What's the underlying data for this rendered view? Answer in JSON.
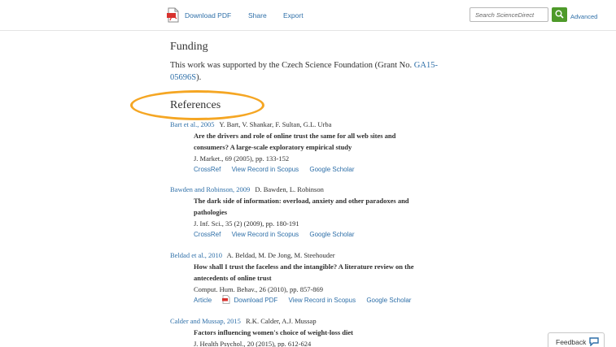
{
  "toolbar": {
    "download_pdf": "Download PDF",
    "share": "Share",
    "export": "Export",
    "search_placeholder": "Search ScienceDirect",
    "advanced": "Advanced"
  },
  "funding": {
    "heading": "Funding",
    "text": "This work was supported by the Czech Science Foundation (Grant No.",
    "grant_link": "GA15-05696S",
    "text_end": ")."
  },
  "references": {
    "heading": "References",
    "items": [
      {
        "key": "Bart et al., 2005",
        "authors": "Y. Bart, V. Shankar, F. Sultan, G.L. Urba",
        "title_line1": "Are the drivers and role of online trust the same for all web sites and",
        "title_line2": "consumers? A large-scale exploratory empirical study",
        "source": "J. Market., 69 (2005), pp. 133-152",
        "links": [
          "CrossRef",
          "View Record in Scopus",
          "Google Scholar"
        ]
      },
      {
        "key": "Bawden and Robinson, 2009",
        "authors": "D. Bawden, L. Robinson",
        "title_line1": "The dark side of information: overload, anxiety and other paradoxes and",
        "title_line2": "pathologies",
        "source": "J. Inf. Sci., 35 (2) (2009), pp. 180-191",
        "links": [
          "CrossRef",
          "View Record in Scopus",
          "Google Scholar"
        ]
      },
      {
        "key": "Beldad et al., 2010",
        "authors": "A. Beldad, M. De Jong, M. Steehouder",
        "title_line1": "How shall I trust the faceless and the intangible? A literature review on the",
        "title_line2": "antecedents of online trust",
        "source": "Comput. Hum. Behav., 26 (2010), pp. 857-869",
        "links": [
          "Article",
          "Download PDF",
          "View Record in Scopus",
          "Google Scholar"
        ]
      },
      {
        "key": "Calder and Mussap, 2015",
        "authors": "R.K. Calder, A.J. Mussap",
        "title_line1": "Factors influencing women's choice of weight-loss diet",
        "source": "J. Health Psychol., 20 (2015), pp. 612-624"
      }
    ]
  },
  "feedback": {
    "label": "Feedback"
  },
  "colors": {
    "link": "#2e6fa8",
    "accent_green": "#4e9a2a",
    "highlight": "#f5a623",
    "pdf_red": "#d8322e"
  }
}
